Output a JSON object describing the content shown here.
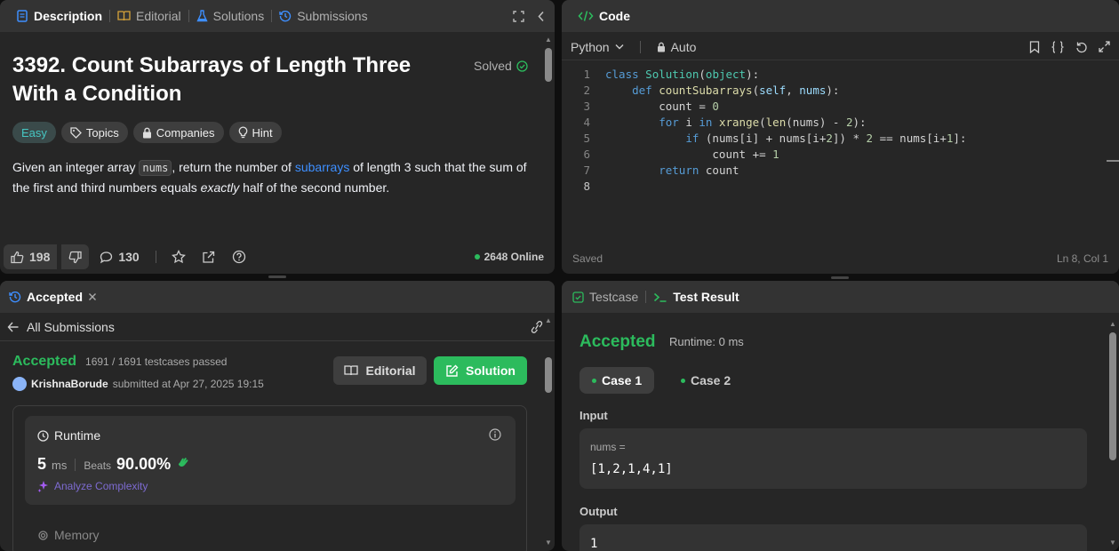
{
  "desc_panel": {
    "tabs": [
      {
        "label": "Description",
        "icon": "document-icon",
        "active": true
      },
      {
        "label": "Editorial",
        "icon": "book-icon",
        "active": false
      },
      {
        "label": "Solutions",
        "icon": "flask-icon",
        "active": false
      },
      {
        "label": "Submissions",
        "icon": "history-icon",
        "active": false
      }
    ],
    "title": "3392. Count Subarrays of Length Three With a Condition",
    "solved_label": "Solved",
    "chips": {
      "difficulty": "Easy",
      "topics": "Topics",
      "companies": "Companies",
      "hint": "Hint"
    },
    "desc_part1": "Given an integer array ",
    "desc_code": "nums",
    "desc_part2": ", return the number of ",
    "desc_link": "subarrays",
    "desc_part3": " of length 3 such that the sum of the first and third numbers equals ",
    "desc_em": "exactly",
    "desc_part4": " half of the second number.",
    "likes": "198",
    "comments": "130",
    "online": "2648 Online"
  },
  "code_panel": {
    "title": "Code",
    "language": "Python",
    "mode": "Auto",
    "status": "Saved",
    "cursor": "Ln 8, Col 1",
    "line_numbers": [
      "1",
      "2",
      "3",
      "4",
      "5",
      "6",
      "7",
      "8"
    ]
  },
  "accepted_panel": {
    "tab_label": "Accepted",
    "back_label": "All Submissions",
    "status": "Accepted",
    "passed": "1691 / 1691 testcases passed",
    "username": "KrishnaBorude",
    "submitted": "submitted at Apr 27, 2025 19:15",
    "editorial_btn": "Editorial",
    "solution_btn": "Solution",
    "runtime_label": "Runtime",
    "runtime_value": "5",
    "runtime_unit": "ms",
    "beats_label": "Beats",
    "beats_value": "90.00%",
    "analyze_label": "Analyze Complexity",
    "memory_label": "Memory"
  },
  "test_panel": {
    "tabs": [
      {
        "label": "Testcase",
        "icon": "checkbox-icon",
        "active": false
      },
      {
        "label": "Test Result",
        "icon": "terminal-icon",
        "active": true
      }
    ],
    "status": "Accepted",
    "runtime": "Runtime: 0 ms",
    "cases": [
      "Case 1",
      "Case 2"
    ],
    "input_label": "Input",
    "input_name": "nums =",
    "input_value": "[1,2,1,4,1]",
    "output_label": "Output",
    "output_value": "1"
  },
  "colors": {
    "accent_green": "#2cbb5d",
    "link_blue": "#3e8fff",
    "easy_teal": "#46c6c2",
    "panel_bg": "#262626",
    "header_bg": "#333333"
  }
}
